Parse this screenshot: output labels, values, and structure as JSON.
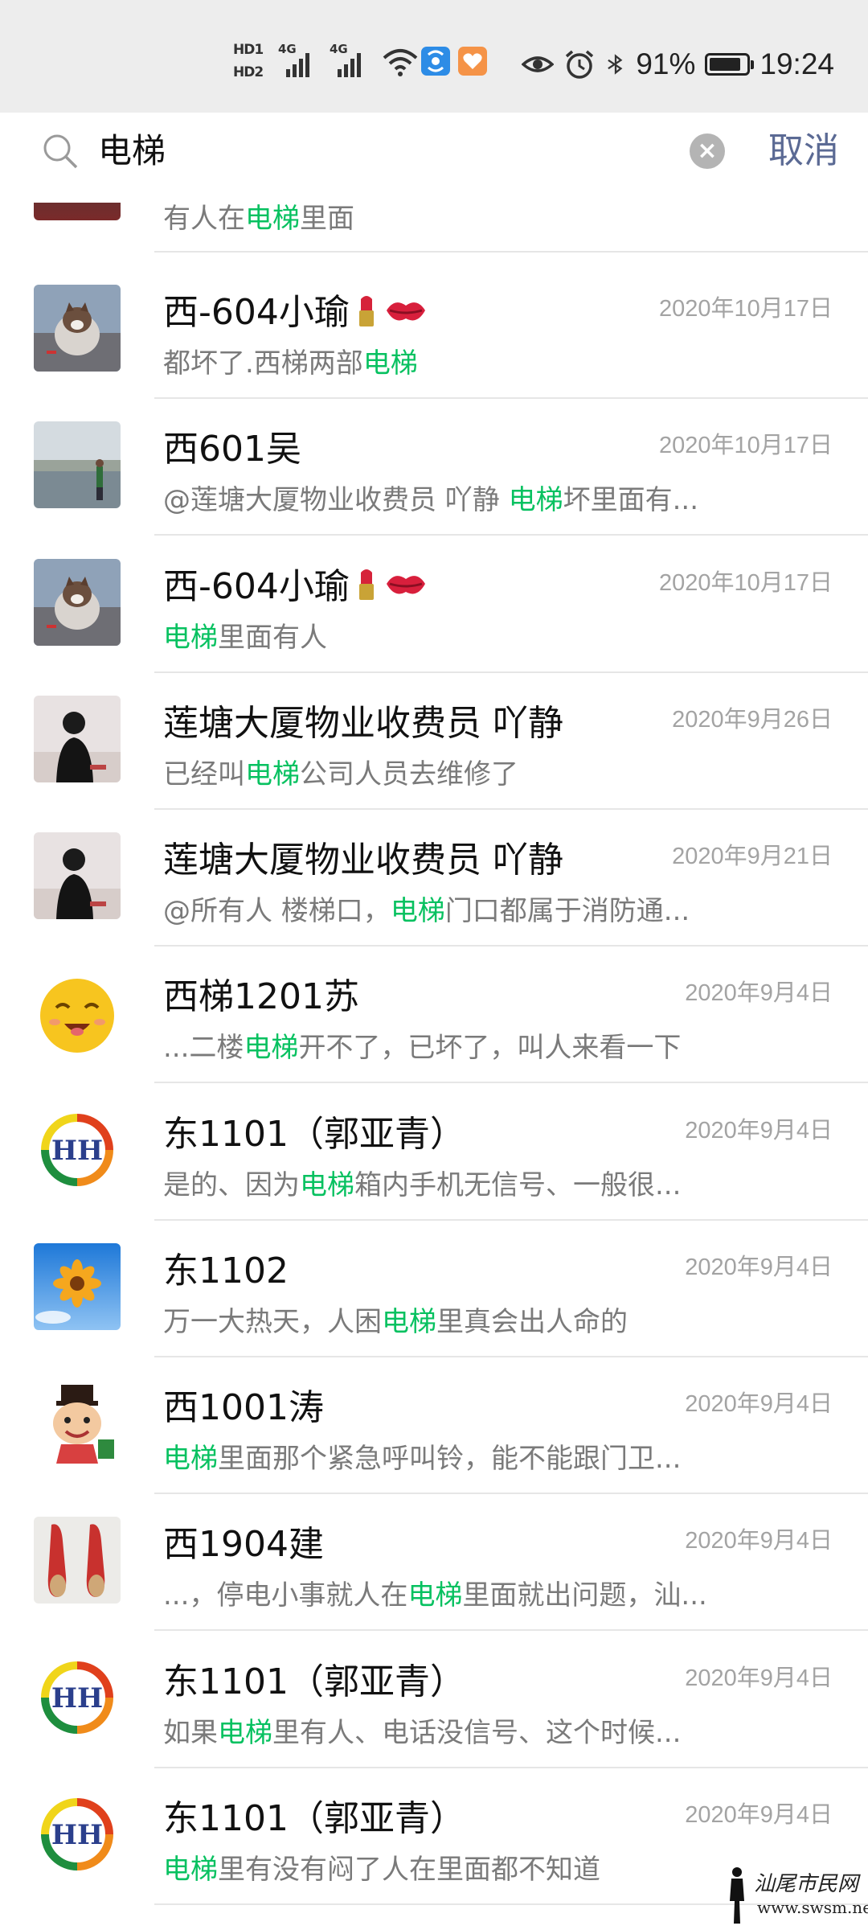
{
  "status_bar": {
    "hd1": "HD1",
    "hd2": "HD2",
    "net1": "4G",
    "net2": "4G",
    "battery_text": "91%",
    "battery_level": 0.91,
    "time": "19:24"
  },
  "search": {
    "value": "电梯",
    "cancel_label": "取消"
  },
  "colors": {
    "highlight": "#07c160",
    "cancel": "#5b6a94"
  },
  "partial_result": {
    "snippet_before": "有人在",
    "keyword": "电梯",
    "snippet_after": "里面"
  },
  "results": [
    {
      "name": "西-604小瑜",
      "emoji": "lipstick kiss",
      "date": "2020年10月17日",
      "before": "都坏了.西梯两部",
      "keyword": "电梯",
      "after": "",
      "avatar": "cat-photo"
    },
    {
      "name": "西601吴",
      "emoji": "",
      "date": "2020年10月17日",
      "before": "@莲塘大厦物业收费员 吖静 ",
      "keyword": "电梯",
      "after": "坏里面有...",
      "avatar": "lake-photo"
    },
    {
      "name": "西-604小瑜",
      "emoji": "lipstick kiss",
      "date": "2020年10月17日",
      "before": "",
      "keyword": "电梯",
      "after": "里面有人",
      "avatar": "cat-photo"
    },
    {
      "name": "莲塘大厦物业收费员  吖静",
      "emoji": "",
      "date": "2020年9月26日",
      "before": "已经叫",
      "keyword": "电梯",
      "after": "公司人员去维修了",
      "avatar": "girl-photo"
    },
    {
      "name": "莲塘大厦物业收费员  吖静",
      "emoji": "",
      "date": "2020年9月21日",
      "before": "@所有人  楼梯口，",
      "keyword": "电梯",
      "after": "门口都属于消防通...",
      "avatar": "girl-photo"
    },
    {
      "name": "西梯1201苏",
      "emoji": "",
      "date": "2020年9月4日",
      "before": "...二楼",
      "keyword": "电梯",
      "after": "开不了，已坏了，叫人来看一下",
      "avatar": "smiley-face"
    },
    {
      "name": "东1101（郭亚青）",
      "emoji": "",
      "date": "2020年9月4日",
      "before": "是的、因为",
      "keyword": "电梯",
      "after": "箱内手机无信号、一般很...",
      "avatar": "hh-logo"
    },
    {
      "name": "东1102",
      "emoji": "",
      "date": "2020年9月4日",
      "before": "万一大热天，人困",
      "keyword": "电梯",
      "after": "里真会出人命的",
      "avatar": "flower-photo"
    },
    {
      "name": "西1001涛",
      "emoji": "",
      "date": "2020年9月4日",
      "before": "",
      "keyword": "电梯",
      "after": "里面那个紧急呼叫铃，能不能跟门卫...",
      "avatar": "cartoon-man"
    },
    {
      "name": "西1904建",
      "emoji": "",
      "date": "2020年9月4日",
      "before": "...，停电小事就人在",
      "keyword": "电梯",
      "after": "里面就出问题，汕...",
      "avatar": "shoes-photo"
    },
    {
      "name": "东1101（郭亚青）",
      "emoji": "",
      "date": "2020年9月4日",
      "before": "如果",
      "keyword": "电梯",
      "after": "里有人、电话没信号、这个时候...",
      "avatar": "hh-logo"
    },
    {
      "name": "东1101（郭亚青）",
      "emoji": "",
      "date": "2020年9月4日",
      "before": "",
      "keyword": "电梯",
      "after": "里有没有闷了人在里面都不知道",
      "avatar": "hh-logo"
    }
  ],
  "watermark": {
    "text": "汕尾市民网",
    "url": "www.swsm.net"
  }
}
